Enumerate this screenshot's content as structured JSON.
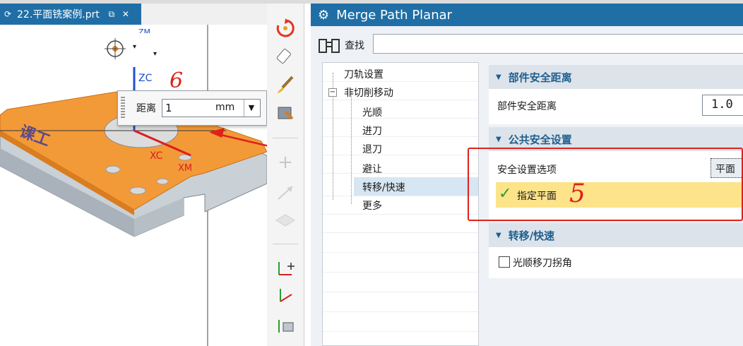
{
  "file_tab": {
    "title": "22.平面铣案例.prt"
  },
  "viewport": {
    "axis_labels": {
      "zc": "ZC",
      "xc": "XC",
      "xm": "XM",
      "zm": "ZM"
    },
    "part_text": "课工",
    "popup": {
      "label": "距离",
      "value": "1",
      "unit": "mm"
    },
    "annotation_6": "6",
    "annotation_5": "5"
  },
  "dialog": {
    "title": "Merge Path Planar",
    "search_label": "查找",
    "tree": [
      {
        "label": "刀轨设置",
        "level": 0
      },
      {
        "label": "非切削移动",
        "level": 0
      },
      {
        "label": "光顺",
        "level": 1
      },
      {
        "label": "进刀",
        "level": 1
      },
      {
        "label": "退刀",
        "level": 1
      },
      {
        "label": "避让",
        "level": 1
      },
      {
        "label": "转移/快速",
        "level": 1
      },
      {
        "label": "更多",
        "level": 1
      }
    ],
    "sections": {
      "part_safe": {
        "header": "部件安全距离",
        "label": "部件安全距离",
        "value": "1.0"
      },
      "common_safe": {
        "header": "公共安全设置",
        "label": "安全设置选项",
        "value": "平面",
        "specify": "指定平面"
      },
      "transfer": {
        "header": "转移/快速",
        "checkbox_label": "光顺移刀拐角"
      }
    }
  },
  "colors": {
    "title_bar": "#1f6fa6",
    "highlight": "#fde38a",
    "annotation": "#e0211b",
    "part": "#f39a38"
  }
}
